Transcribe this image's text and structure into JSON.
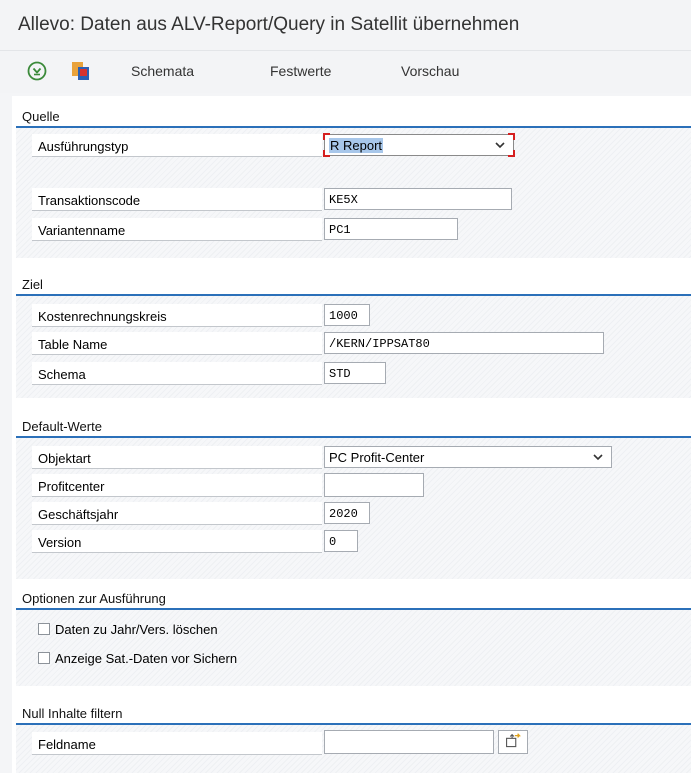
{
  "window": {
    "title": "Allevo: Daten aus ALV-Report/Query in Satellit übernehmen"
  },
  "toolbar": {
    "execute_icon": "execute-icon",
    "copy_icon": "copy-document-icon",
    "buttons": [
      "Schemata",
      "Festwerte",
      "Vorschau"
    ]
  },
  "quelle": {
    "heading": "Quelle",
    "ausfuehrungstyp_label": "Ausführungstyp",
    "ausfuehrungstyp_value": "R Report",
    "transaktionscode_label": "Transaktionscode",
    "transaktionscode_value": "KE5X",
    "variantenname_label": "Variantenname",
    "variantenname_value": "PC1"
  },
  "ziel": {
    "heading": "Ziel",
    "kostenrechnungskreis_label": "Kostenrechnungskreis",
    "kostenrechnungskreis_value": "1000",
    "table_name_label": "Table Name",
    "table_name_value": "/KERN/IPPSAT80",
    "schema_label": "Schema",
    "schema_value": "STD"
  },
  "default_werte": {
    "heading": "Default-Werte",
    "objektart_label": "Objektart",
    "objektart_value": "PC Profit-Center",
    "profitcenter_label": "Profitcenter",
    "profitcenter_value": "",
    "geschaeftsjahr_label": "Geschäftsjahr",
    "geschaeftsjahr_value": "2020",
    "version_label": "Version",
    "version_value": "0"
  },
  "optionen": {
    "heading": "Optionen zur Ausführung",
    "checkbox_1": "Daten zu Jahr/Vers. löschen",
    "checkbox_1_checked": false,
    "checkbox_2": "Anzeige Sat.-Daten vor Sichern",
    "checkbox_2_checked": false
  },
  "null_filter": {
    "heading": "Null Inhalte filtern",
    "feldname_label": "Feldname",
    "feldname_value": "",
    "value_help_icon": "value-help-icon"
  },
  "colors": {
    "group_underline": "#2b70b9",
    "focus_corner": "#d51f1f",
    "selection_highlight": "#a8c7ea"
  }
}
